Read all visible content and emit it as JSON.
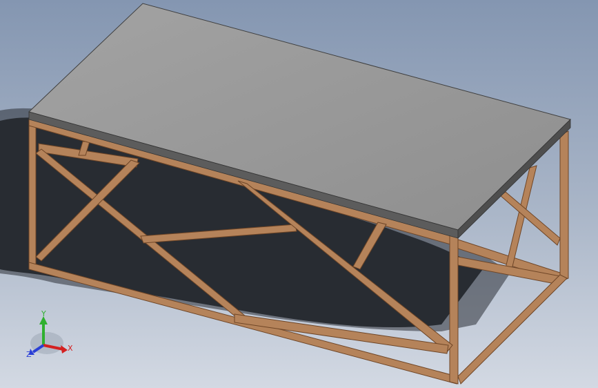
{
  "viewport": {
    "background_top": "#8a9bb5",
    "background_bottom": "#d4dae4",
    "shadow_color": "#1e2228"
  },
  "model": {
    "top_color": "#9a9a9a",
    "top_edge_color": "#5e5e5e",
    "frame_color": "#b5835a",
    "frame_dark": "#7a4e2c",
    "frame_light": "#d9a47c"
  },
  "triad": {
    "x_label": "X",
    "y_label": "Y",
    "z_label": "Z",
    "x_color": "#d42020",
    "y_color": "#2fb02f",
    "z_color": "#2a3fd6"
  }
}
